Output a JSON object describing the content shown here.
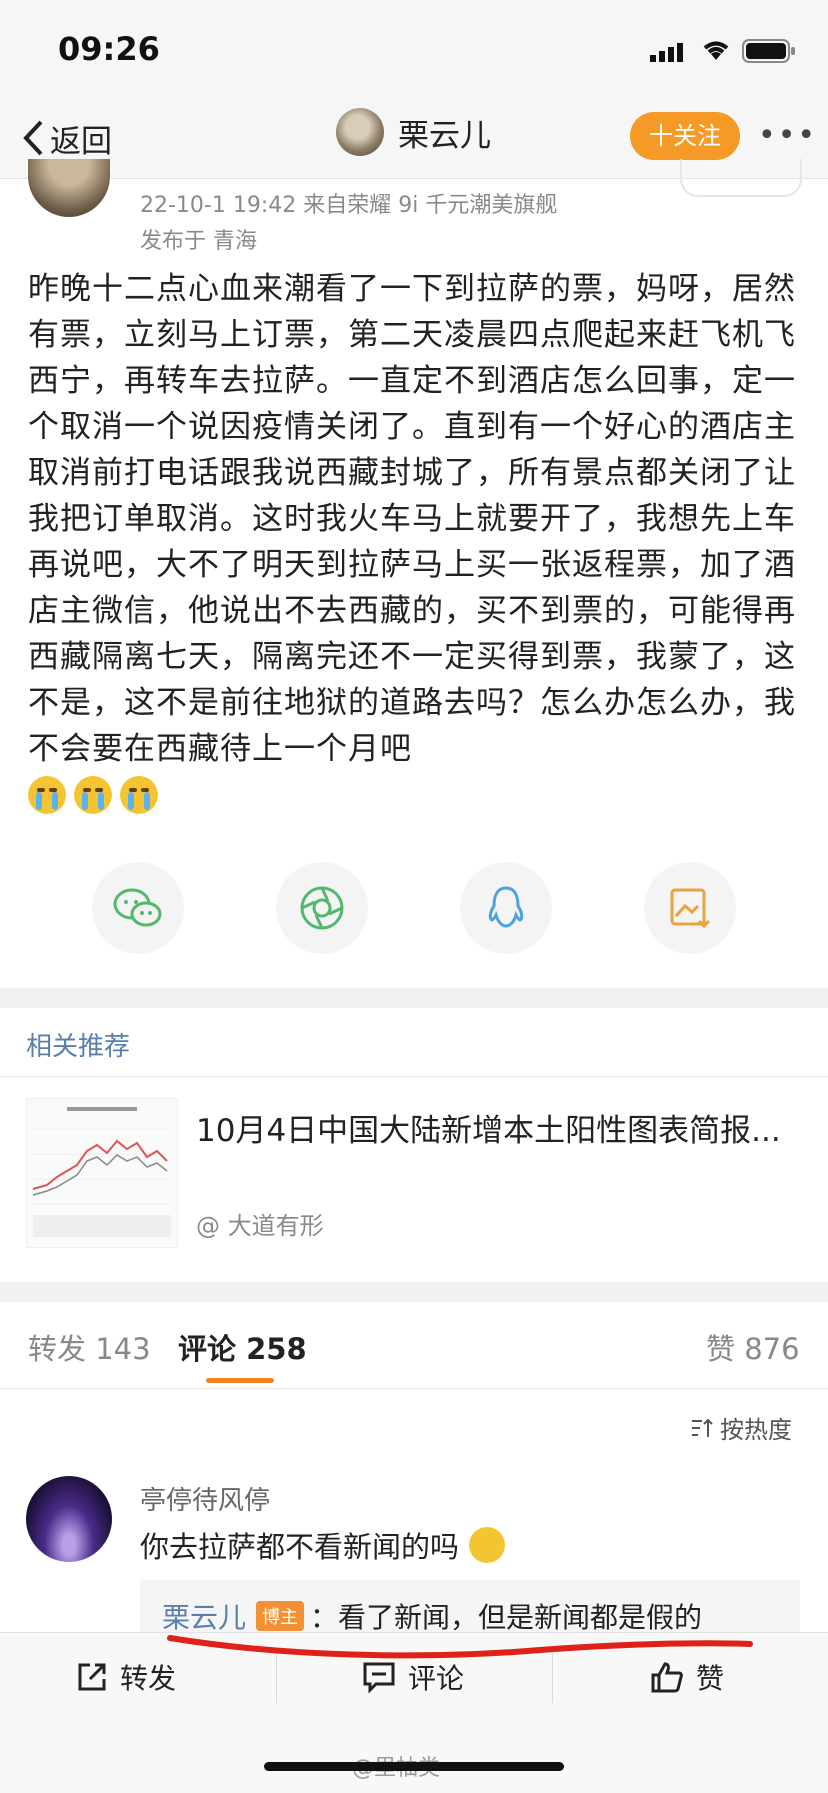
{
  "status_bar": {
    "time": "09:26"
  },
  "nav": {
    "back_label": "返回",
    "user_name": "栗云儿",
    "follow_label": "十关注",
    "more_label": "•••"
  },
  "post": {
    "meta": "22-10-1 19:42  来自荣耀 9i 千元潮美旗舰",
    "location": "发布于 青海",
    "text": "昨晚十二点心血来潮看了一下到拉萨的票，妈呀，居然有票，立刻马上订票，第二天凌晨四点爬起来赶飞机飞西宁，再转车去拉萨。一直定不到酒店怎么回事，定一个取消一个说因疫情关闭了。直到有一个好心的酒店主取消前打电话跟我说西藏封城了，所有景点都关闭了让我把订单取消。这时我火车马上就要开了，我想先上车再说吧，大不了明天到拉萨马上买一张返程票，加了酒店主微信，他说出不去西藏的，买不到票的，可能得再西藏隔离七天，隔离完还不一定买得到票，我蒙了，这不是，这不是前往地狱的道路去吗？怎么办怎么办，我不会要在西藏待上一个月吧"
  },
  "share_buttons": [
    "wechat-icon",
    "moments-icon",
    "qq-icon",
    "save-image-icon"
  ],
  "related": {
    "title": "相关推荐",
    "item_title": "10月4日中国大陆新增本土阳性图表简报...",
    "item_source": "@ 大道有形"
  },
  "tabs": {
    "repost": "转发 143",
    "comments": "评论 258",
    "likes": "赞 876"
  },
  "sort_label": "按热度",
  "comment": {
    "user": "亭停待风停",
    "text": "你去拉萨都不看新闻的吗",
    "reply_name": "栗云儿",
    "reply_badge": "博主",
    "reply_text": "：看了新闻，但是新闻都是假的"
  },
  "bottom_bar": {
    "repost": "转发",
    "comment": "评论",
    "like": "赞"
  },
  "watermark": "@里柚类",
  "colors": {
    "accent": "#f59a26",
    "link": "#5a7fa8",
    "underline_red": "#e0201a"
  }
}
